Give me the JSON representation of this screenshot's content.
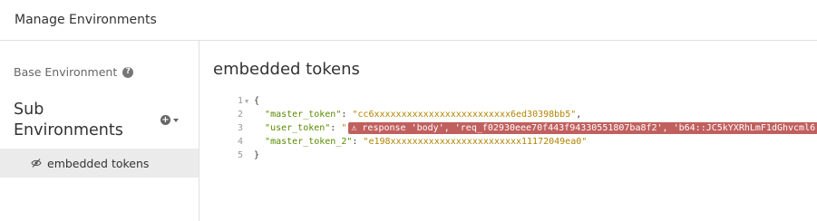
{
  "header": {
    "title": "Manage Environments"
  },
  "sidebar": {
    "base_env_label": "Base Environment",
    "sub_env_title": "Sub Environments",
    "items": [
      {
        "label": "embedded tokens"
      }
    ]
  },
  "main": {
    "title": "embedded tokens",
    "editor": {
      "line_numbers": [
        "1",
        "2",
        "3",
        "4",
        "5"
      ],
      "open_brace": "{",
      "close_brace": "}",
      "entries": [
        {
          "key": "\"master_token\"",
          "sep": ": ",
          "value": "\"cc6xxxxxxxxxxxxxxxxxxxxxxxxx6ed30398bb5\"",
          "trail": ","
        },
        {
          "key": "\"user_token\"",
          "sep": ": ",
          "quote_open": "\"",
          "tag_text": "⚠ response 'body', 'req_f02930eee70f443f94330551807ba8f2', 'b64::JC5kYXRhLmF1dGhvcml6",
          "trail": ""
        },
        {
          "key": "\"master_token_2\"",
          "sep": ": ",
          "value": "\"e198xxxxxxxxxxxxxxxxxxxxxxxx11172049ea0\"",
          "trail": ""
        }
      ]
    }
  }
}
